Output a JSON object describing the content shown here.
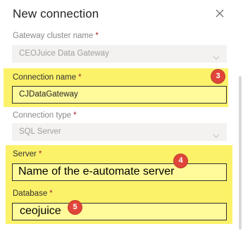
{
  "dialog": {
    "title": "New connection",
    "close_icon": "close-icon"
  },
  "gateway_cluster": {
    "label": "Gateway cluster name",
    "required": "*",
    "value": "CEOJuice Data Gateway",
    "icon": "chevron-down-icon"
  },
  "connection_name": {
    "label": "Connection name",
    "required": "*",
    "value": "CJDataGateway",
    "badge": "3"
  },
  "connection_type": {
    "label": "Connection type",
    "required": "*",
    "value": "SQL Server",
    "icon": "chevron-down-icon"
  },
  "server": {
    "label": "Server",
    "required": "*",
    "value": "Name of the e-automate server",
    "badge": "4"
  },
  "database": {
    "label": "Database",
    "required": "*",
    "value": "ceojuice",
    "badge": "5"
  },
  "colors": {
    "highlight": "#fcf26a",
    "badge": "#e0453a",
    "required": "#a4262c"
  }
}
